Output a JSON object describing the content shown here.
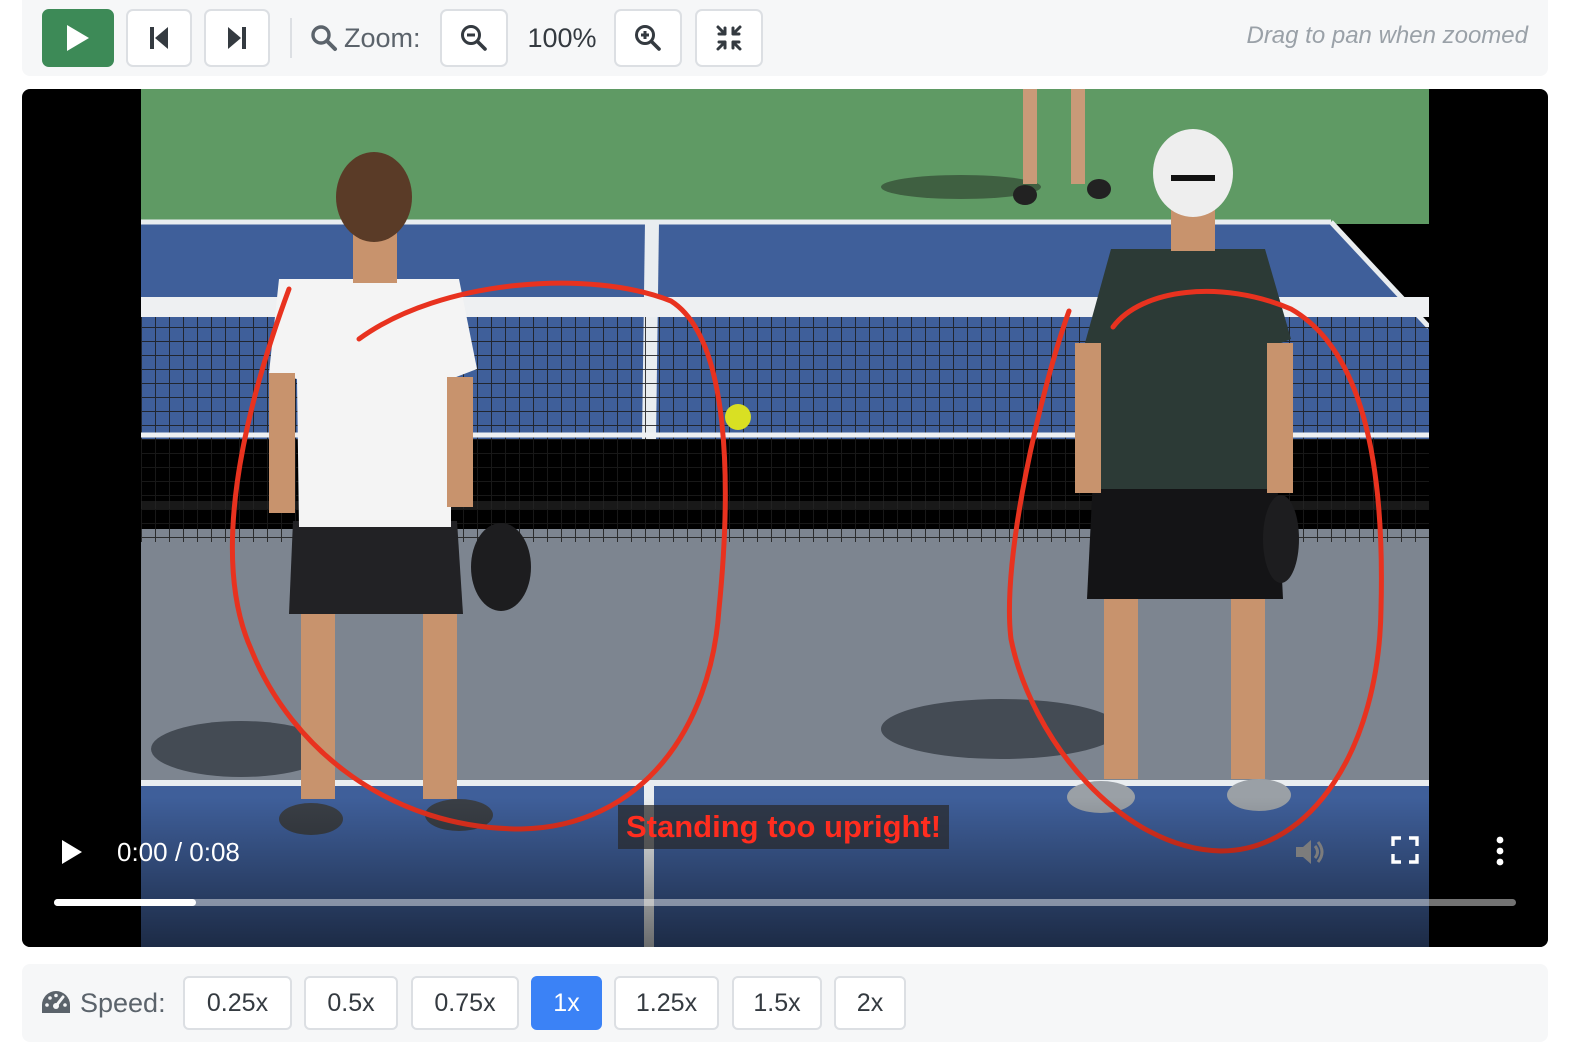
{
  "toolbar": {
    "play_icon": "play-icon",
    "prev_frame_icon": "skip-back-icon",
    "next_frame_icon": "skip-forward-icon",
    "zoom_label": "Zoom:",
    "zoom_out_icon": "zoom-out-icon",
    "zoom_value": "100%",
    "zoom_in_icon": "zoom-in-icon",
    "reset_zoom_icon": "compress-icon",
    "pan_hint": "Drag to pan when zoomed",
    "accent_color": "#3d8a57"
  },
  "video": {
    "caption": "Standing too upright!",
    "time": "0:00 / 0:08",
    "progress_fraction": 0.097,
    "annotation_color": "#e8321f",
    "play_icon": "play-icon",
    "volume_icon": "volume-icon",
    "fullscreen_icon": "fullscreen-icon",
    "more_icon": "more-vertical-icon"
  },
  "speed": {
    "label": "Speed:",
    "icon": "gauge-icon",
    "options": [
      "0.25x",
      "0.5x",
      "0.75x",
      "1x",
      "1.25x",
      "1.5x",
      "2x"
    ],
    "selected": "1x",
    "active_color": "#3b82f6"
  }
}
